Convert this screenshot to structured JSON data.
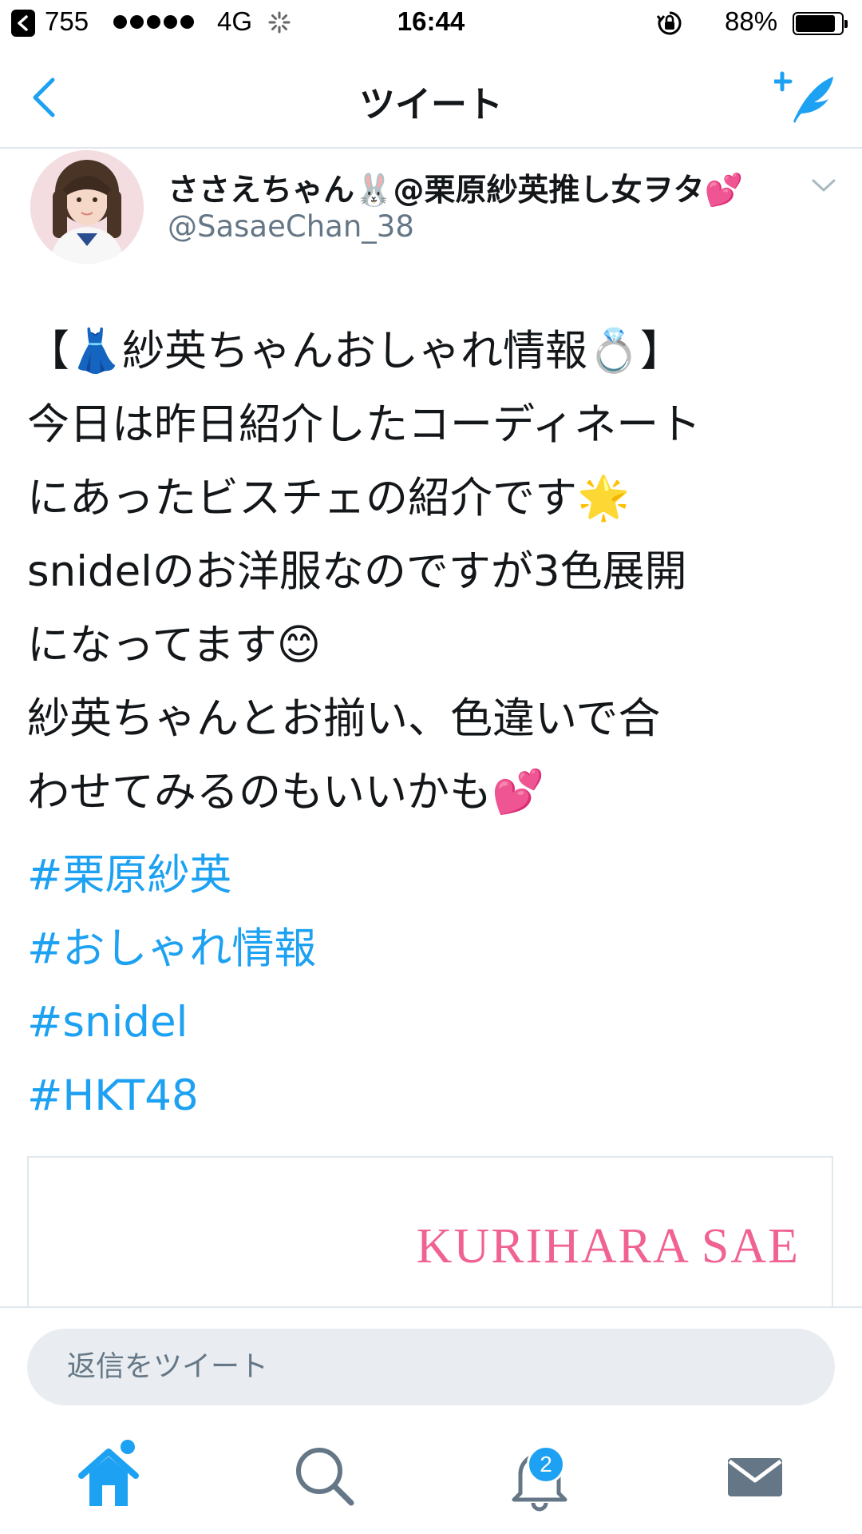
{
  "status_bar": {
    "carrier_count": "755",
    "network": "4G",
    "time": "16:44",
    "battery_percent": "88%",
    "battery_level": 0.88
  },
  "nav": {
    "title": "ツイート"
  },
  "tweet": {
    "author_name": "ささえちゃん🐰@栗原紗英推し女ヲタ💕",
    "author_handle": "@SasaeChan_38",
    "text": "【👗紗英ちゃんおしゃれ情報💍】\n今日は昨日紹介したコーディネート\nにあったビスチェの紹介です🌟\nsnidelのお洋服なのですが3色展開\nになってます😊\n紗英ちゃんとお揃い、色違いで合\nわせてみるのもいいかも💕",
    "hashtags": [
      "#栗原紗英",
      "#おしゃれ情報",
      "#snidel",
      "#HKT48"
    ],
    "media_caption": "KURIHARA SAE"
  },
  "reply": {
    "placeholder": "返信をツイート"
  },
  "tab_bar": {
    "notifications_badge": "2"
  },
  "colors": {
    "accent": "#1da1f2",
    "text": "#14171a",
    "secondary": "#657786",
    "media_caption": "#f06292"
  }
}
